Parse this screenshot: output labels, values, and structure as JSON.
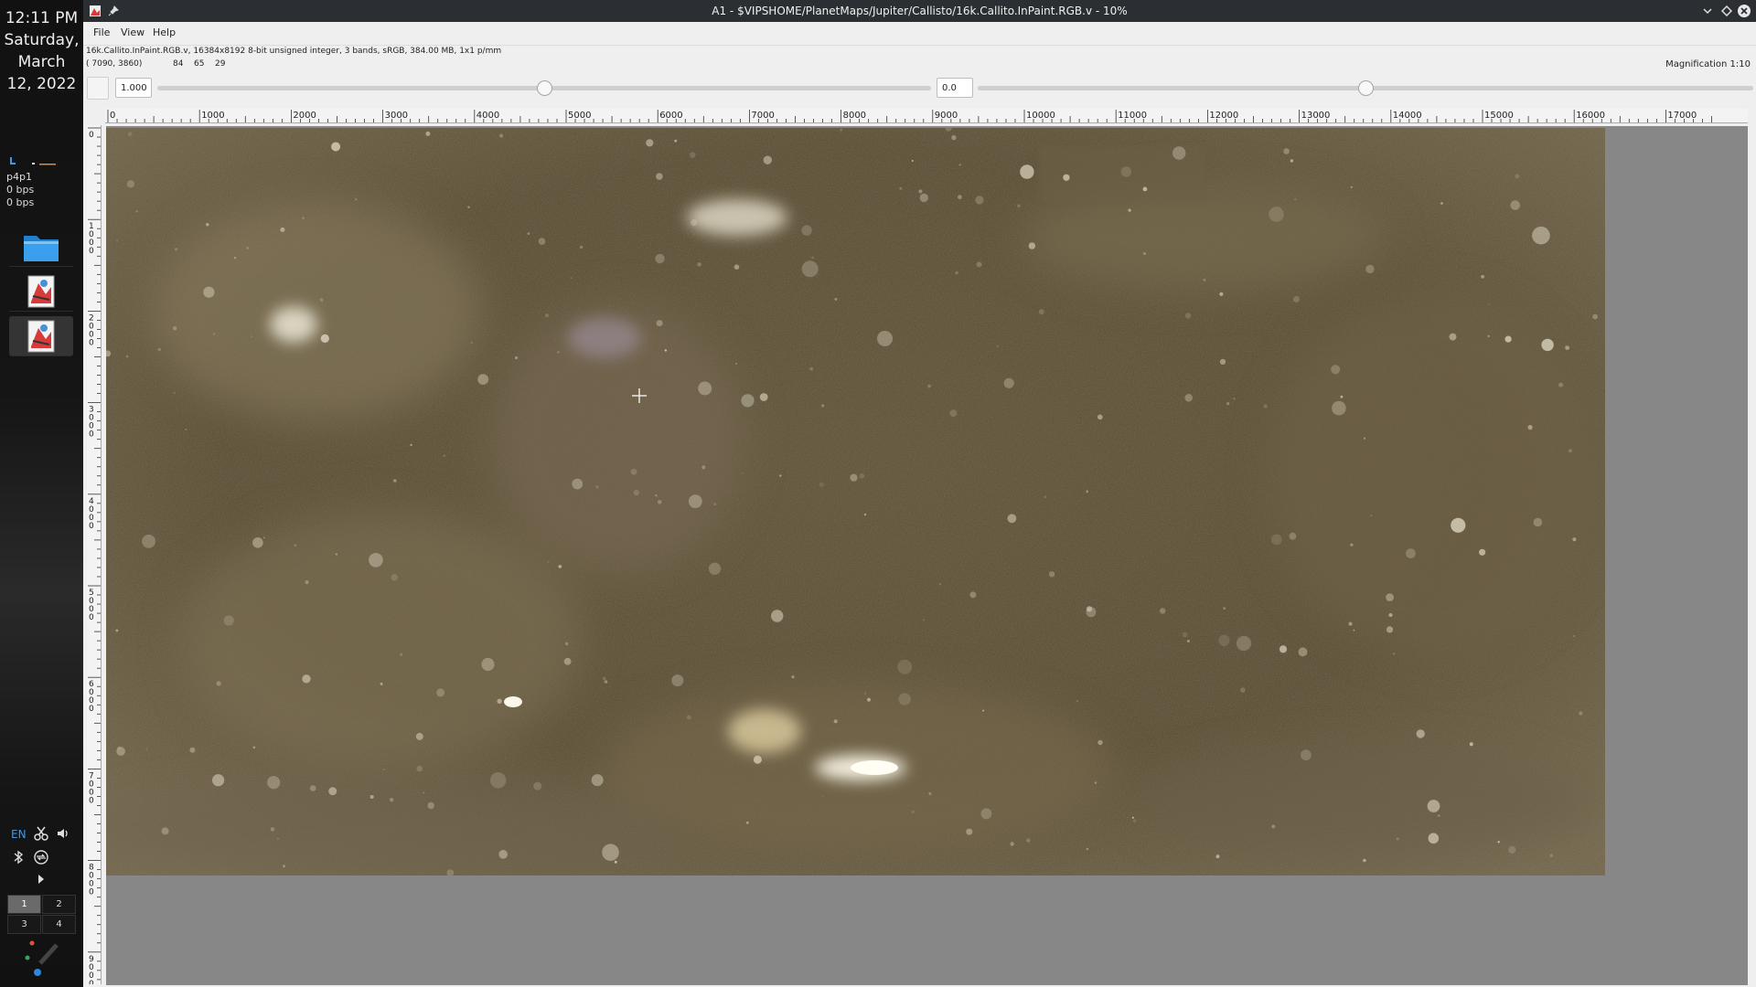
{
  "panel": {
    "clock": {
      "time": "12:11 PM",
      "day": "Saturday,",
      "month": "March",
      "date": "12, 2022"
    },
    "network": {
      "interface": "p4p1",
      "up": "0 bps",
      "down": "0 bps"
    },
    "tasks": [
      {
        "name": "file-manager",
        "icon": "folder-icon"
      },
      {
        "name": "vips-window-1",
        "icon": "vips-icon"
      },
      {
        "name": "vips-window-2",
        "icon": "vips-icon"
      }
    ],
    "tray": {
      "language": "EN"
    },
    "pager": [
      "1",
      "2",
      "3",
      "4"
    ]
  },
  "window": {
    "title": "A1 - $VIPSHOME/PlanetMaps/Jupiter/Callisto/16k.Callito.InPaint.RGB.v - 10%",
    "menu": {
      "file": "File",
      "view": "View",
      "help": "Help"
    },
    "info": {
      "header": "16k.Callito.InPaint.RGB.v, 16384x8192 8-bit unsigned integer, 3 bands, sRGB, 384.00 MB, 1x1 p/mm",
      "coords": "( 7090,  3860)",
      "pixel": [
        "84",
        "65",
        "29"
      ],
      "magnification": "Magnification 1:10"
    },
    "toolbar": {
      "scale": "1.000",
      "offset": "0.0",
      "scale_slider": 0.5,
      "offset_slider": 0.5
    },
    "ruler": {
      "h_labels": [
        "0",
        "1000",
        "2000",
        "3000",
        "4000",
        "5000",
        "6000",
        "7000",
        "8000",
        "9000",
        "10000",
        "11000",
        "12000",
        "13000",
        "14000",
        "15000",
        "16000",
        "17000"
      ],
      "v_labels": [
        "0",
        "1000",
        "2000",
        "3000",
        "4000",
        "5000",
        "6000",
        "7000",
        "8000",
        "9000"
      ]
    },
    "colors": {
      "titlebar": "#2b2f33",
      "canvas_bg": "#878787",
      "map_base": "#5e5236",
      "accent": "#3d9be9"
    }
  }
}
